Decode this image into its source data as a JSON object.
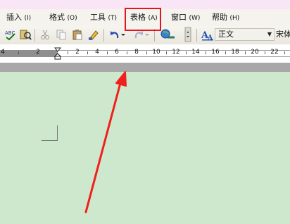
{
  "menu": [
    {
      "label": "插入",
      "mnemonic": "(I)"
    },
    {
      "label": "格式",
      "mnemonic": "(O)"
    },
    {
      "label": "工具",
      "mnemonic": "(T)"
    },
    {
      "label": "表格",
      "mnemonic": "(A)"
    },
    {
      "label": "窗口",
      "mnemonic": "(W)"
    },
    {
      "label": "帮助",
      "mnemonic": "(H)"
    }
  ],
  "toolbar": {
    "style_value": "正文",
    "font_value": "宋体"
  },
  "ruler": {
    "numbers": [
      "4",
      "2",
      "2",
      "4",
      "6",
      "8",
      "10",
      "12",
      "14",
      "16",
      "18",
      "20",
      "22"
    ]
  },
  "colors": {
    "document_bg": "#cde8cd",
    "highlight": "#e8141d",
    "arrow": "#f0201c"
  },
  "icons": [
    "spellcheck-icon",
    "research-icon",
    "cut-icon",
    "copy-icon",
    "paste-icon",
    "format-painter-icon",
    "undo-icon",
    "redo-icon",
    "hyperlink-icon",
    "styles-pane-icon"
  ]
}
